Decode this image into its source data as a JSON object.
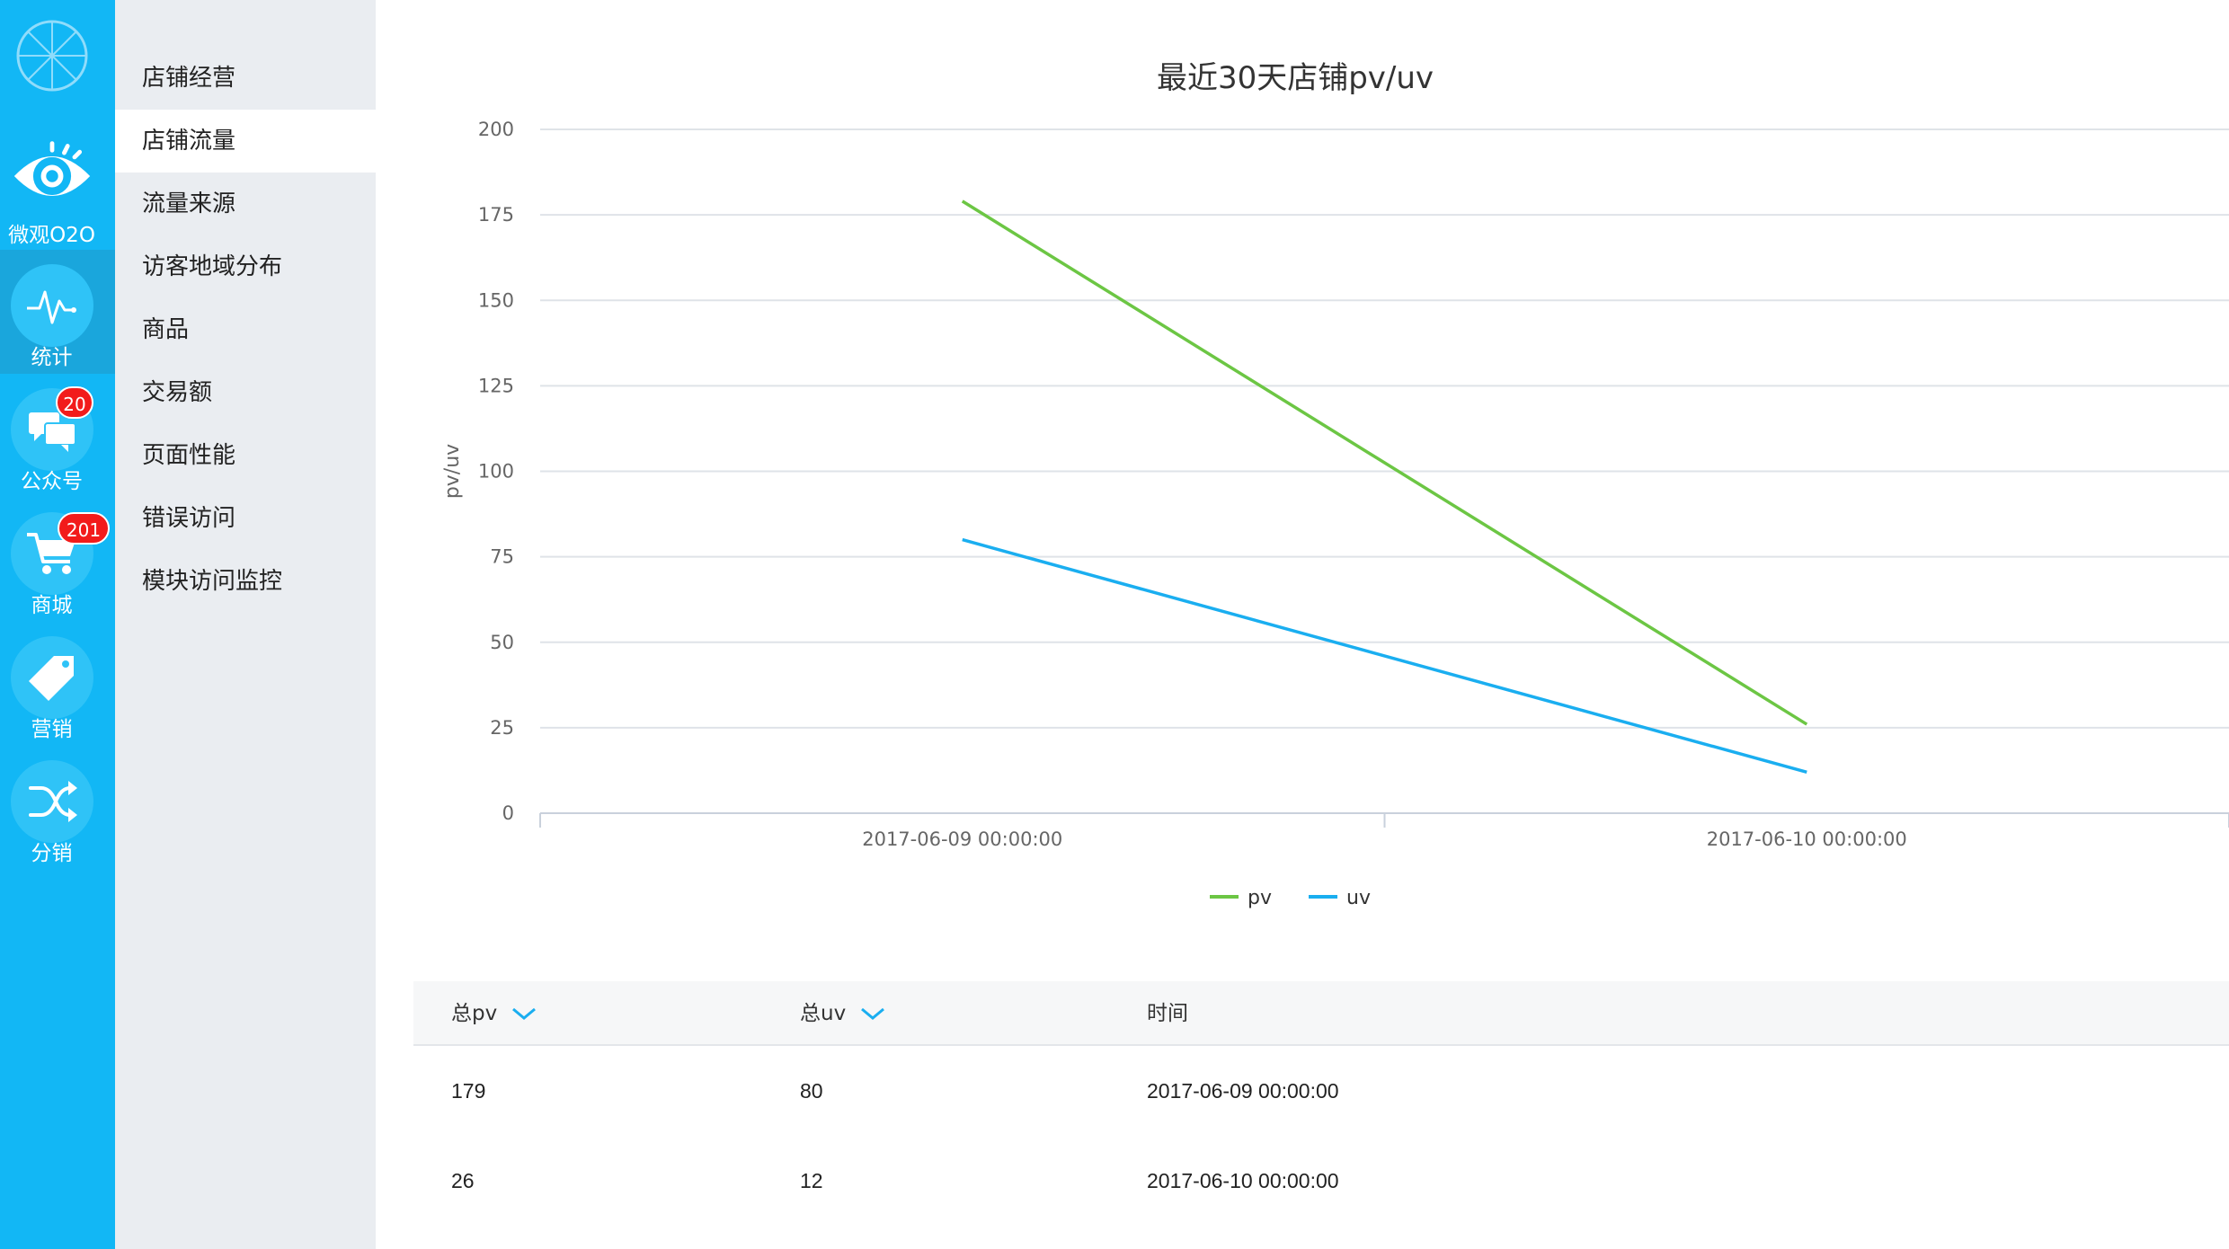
{
  "rail": {
    "items": [
      {
        "label": "微观O2O",
        "icon": "eye-icon"
      },
      {
        "label": "统计",
        "icon": "pulse-icon"
      },
      {
        "label": "公众号",
        "icon": "chat-icon",
        "badge": "20"
      },
      {
        "label": "商城",
        "icon": "cart-icon",
        "badge": "201"
      },
      {
        "label": "营销",
        "icon": "tag-icon"
      },
      {
        "label": "分销",
        "icon": "shuffle-icon"
      }
    ]
  },
  "menu": {
    "items": [
      {
        "label": "店铺经营"
      },
      {
        "label": "店铺流量"
      },
      {
        "label": "流量来源"
      },
      {
        "label": "访客地域分布"
      },
      {
        "label": "商品"
      },
      {
        "label": "交易额"
      },
      {
        "label": "页面性能"
      },
      {
        "label": "错误访问"
      },
      {
        "label": "模块访问监控"
      }
    ],
    "active_index": 1
  },
  "chart_data": {
    "type": "line",
    "title": "最近30天店铺pv/uv",
    "ylabel": "pv/uv",
    "xlabel": "",
    "categories": [
      "2017-06-09 00:00:00",
      "2017-06-10 00:00:00"
    ],
    "ylim": [
      0,
      200
    ],
    "yticks": [
      0,
      25,
      50,
      75,
      100,
      125,
      150,
      175,
      200
    ],
    "series": [
      {
        "name": "pv",
        "values": [
          179,
          26
        ],
        "color": "#6cc644"
      },
      {
        "name": "uv",
        "values": [
          80,
          12
        ],
        "color": "#1aaef0"
      }
    ],
    "grid": true,
    "legend": "bottom-center"
  },
  "table": {
    "headers": [
      "总pv",
      "总uv",
      "时间"
    ],
    "rows": [
      [
        "179",
        "80",
        "2017-06-09 00:00:00"
      ],
      [
        "26",
        "12",
        "2017-06-10 00:00:00"
      ]
    ]
  },
  "colors": {
    "rail_bg": "#12b7f5",
    "menu_bg": "#eaedf1",
    "badge": "#f21b1b"
  }
}
